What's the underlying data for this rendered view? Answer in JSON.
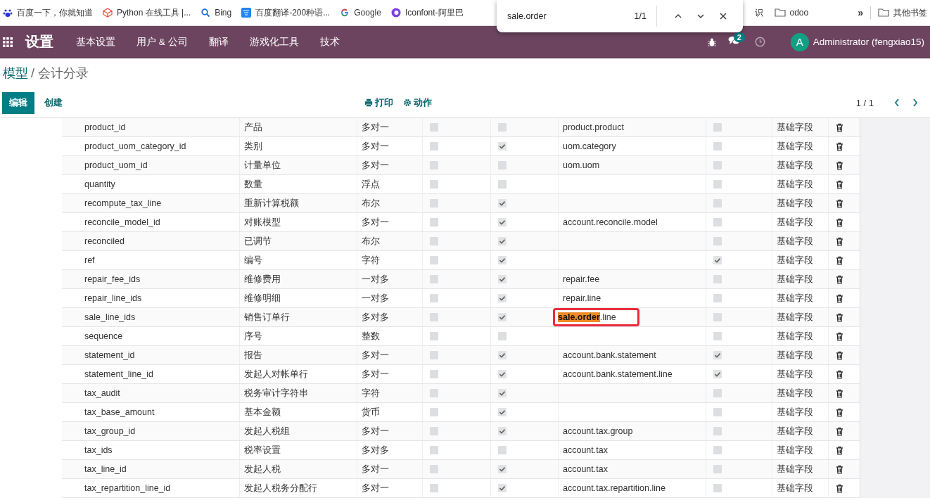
{
  "bookmarks": [
    "百度一下，你就知道",
    "Python 在线工具 |...",
    "Bing",
    "百度翻译-200种语...",
    "Google",
    "Iconfont-阿里巴"
  ],
  "bookmarks_right": [
    "识",
    "odoo"
  ],
  "bookmarks_overflow": "»",
  "other_bookmarks": "其他书签",
  "find_bar": {
    "query": "sale.order",
    "count": "1/1"
  },
  "navbar": {
    "app": "设置",
    "menu": [
      "基本设置",
      "用户 & 公司",
      "翻译",
      "游戏化工具",
      "技术"
    ],
    "messages_badge": "2",
    "avatar": "A",
    "user": "Administrator (fengxiao15)"
  },
  "breadcrumb": {
    "parent": "模型",
    "current": "/ 会计分录"
  },
  "buttons": {
    "edit": "编辑",
    "create": "创建",
    "print": "打印",
    "action": "动作"
  },
  "pager": "1 / 1",
  "rows": [
    {
      "name": "product_id",
      "label": "产品",
      "type": "多对一",
      "c1": false,
      "c2": false,
      "relation": "product.product",
      "c3": false,
      "base": "基础字段"
    },
    {
      "name": "product_uom_category_id",
      "label": "类别",
      "type": "多对一",
      "c1": false,
      "c2": true,
      "relation": "uom.category",
      "c3": false,
      "base": "基础字段"
    },
    {
      "name": "product_uom_id",
      "label": "计量单位",
      "type": "多对一",
      "c1": false,
      "c2": false,
      "relation": "uom.uom",
      "c3": false,
      "base": "基础字段"
    },
    {
      "name": "quantity",
      "label": "数量",
      "type": "浮点",
      "c1": false,
      "c2": false,
      "c3": false,
      "base": "基础字段"
    },
    {
      "name": "recompute_tax_line",
      "label": "重新计算税额",
      "type": "布尔",
      "c1": false,
      "c2": true,
      "c3": false,
      "base": "基础字段"
    },
    {
      "name": "reconcile_model_id",
      "label": "对账模型",
      "type": "多对一",
      "c1": false,
      "c2": true,
      "relation": "account.reconcile.model",
      "c3": false,
      "base": "基础字段"
    },
    {
      "name": "reconciled",
      "label": "已调节",
      "type": "布尔",
      "c1": false,
      "c2": true,
      "c3": false,
      "base": "基础字段"
    },
    {
      "name": "ref",
      "label": "编号",
      "type": "字符",
      "c1": false,
      "c2": true,
      "c3": true,
      "base": "基础字段"
    },
    {
      "name": "repair_fee_ids",
      "label": "维修费用",
      "type": "一对多",
      "c1": false,
      "c2": true,
      "relation": "repair.fee",
      "c3": false,
      "base": "基础字段"
    },
    {
      "name": "repair_line_ids",
      "label": "维修明细",
      "type": "一对多",
      "c1": false,
      "c2": true,
      "relation": "repair.line",
      "c3": false,
      "base": "基础字段"
    },
    {
      "name": "sale_line_ids",
      "label": "销售订单行",
      "type": "多对多",
      "c1": false,
      "c2": true,
      "relation_parts": [
        {
          "text": "sale.order",
          "highlighted": true
        },
        {
          "text": ".line",
          "highlighted": false
        }
      ],
      "boxed": true,
      "c3": false,
      "base": "基础字段"
    },
    {
      "name": "sequence",
      "label": "序号",
      "type": "整数",
      "c1": false,
      "c2": false,
      "c3": false,
      "base": "基础字段"
    },
    {
      "name": "statement_id",
      "label": "报告",
      "type": "多对一",
      "c1": false,
      "c2": true,
      "relation": "account.bank.statement",
      "c3": true,
      "base": "基础字段"
    },
    {
      "name": "statement_line_id",
      "label": "发起人对帐单行",
      "type": "多对一",
      "c1": false,
      "c2": true,
      "relation": "account.bank.statement.line",
      "c3": true,
      "base": "基础字段"
    },
    {
      "name": "tax_audit",
      "label": "税务审计字符串",
      "type": "字符",
      "c1": false,
      "c2": true,
      "c3": false,
      "base": "基础字段"
    },
    {
      "name": "tax_base_amount",
      "label": "基本金额",
      "type": "货币",
      "c1": false,
      "c2": true,
      "c3": false,
      "base": "基础字段"
    },
    {
      "name": "tax_group_id",
      "label": "发起人税组",
      "type": "多对一",
      "c1": false,
      "c2": true,
      "relation": "account.tax.group",
      "c3": false,
      "base": "基础字段"
    },
    {
      "name": "tax_ids",
      "label": "税率设置",
      "type": "多对多",
      "c1": false,
      "c2": false,
      "relation": "account.tax",
      "c3": false,
      "base": "基础字段"
    },
    {
      "name": "tax_line_id",
      "label": "发起人税",
      "type": "多对一",
      "c1": false,
      "c2": true,
      "relation": "account.tax",
      "c3": false,
      "base": "基础字段"
    },
    {
      "name": "tax_repartition_line_id",
      "label": "发起人税务分配行",
      "type": "多对一",
      "c1": false,
      "c2": true,
      "relation": "account.tax.repartition.line",
      "c3": false,
      "base": "基础字段"
    }
  ]
}
